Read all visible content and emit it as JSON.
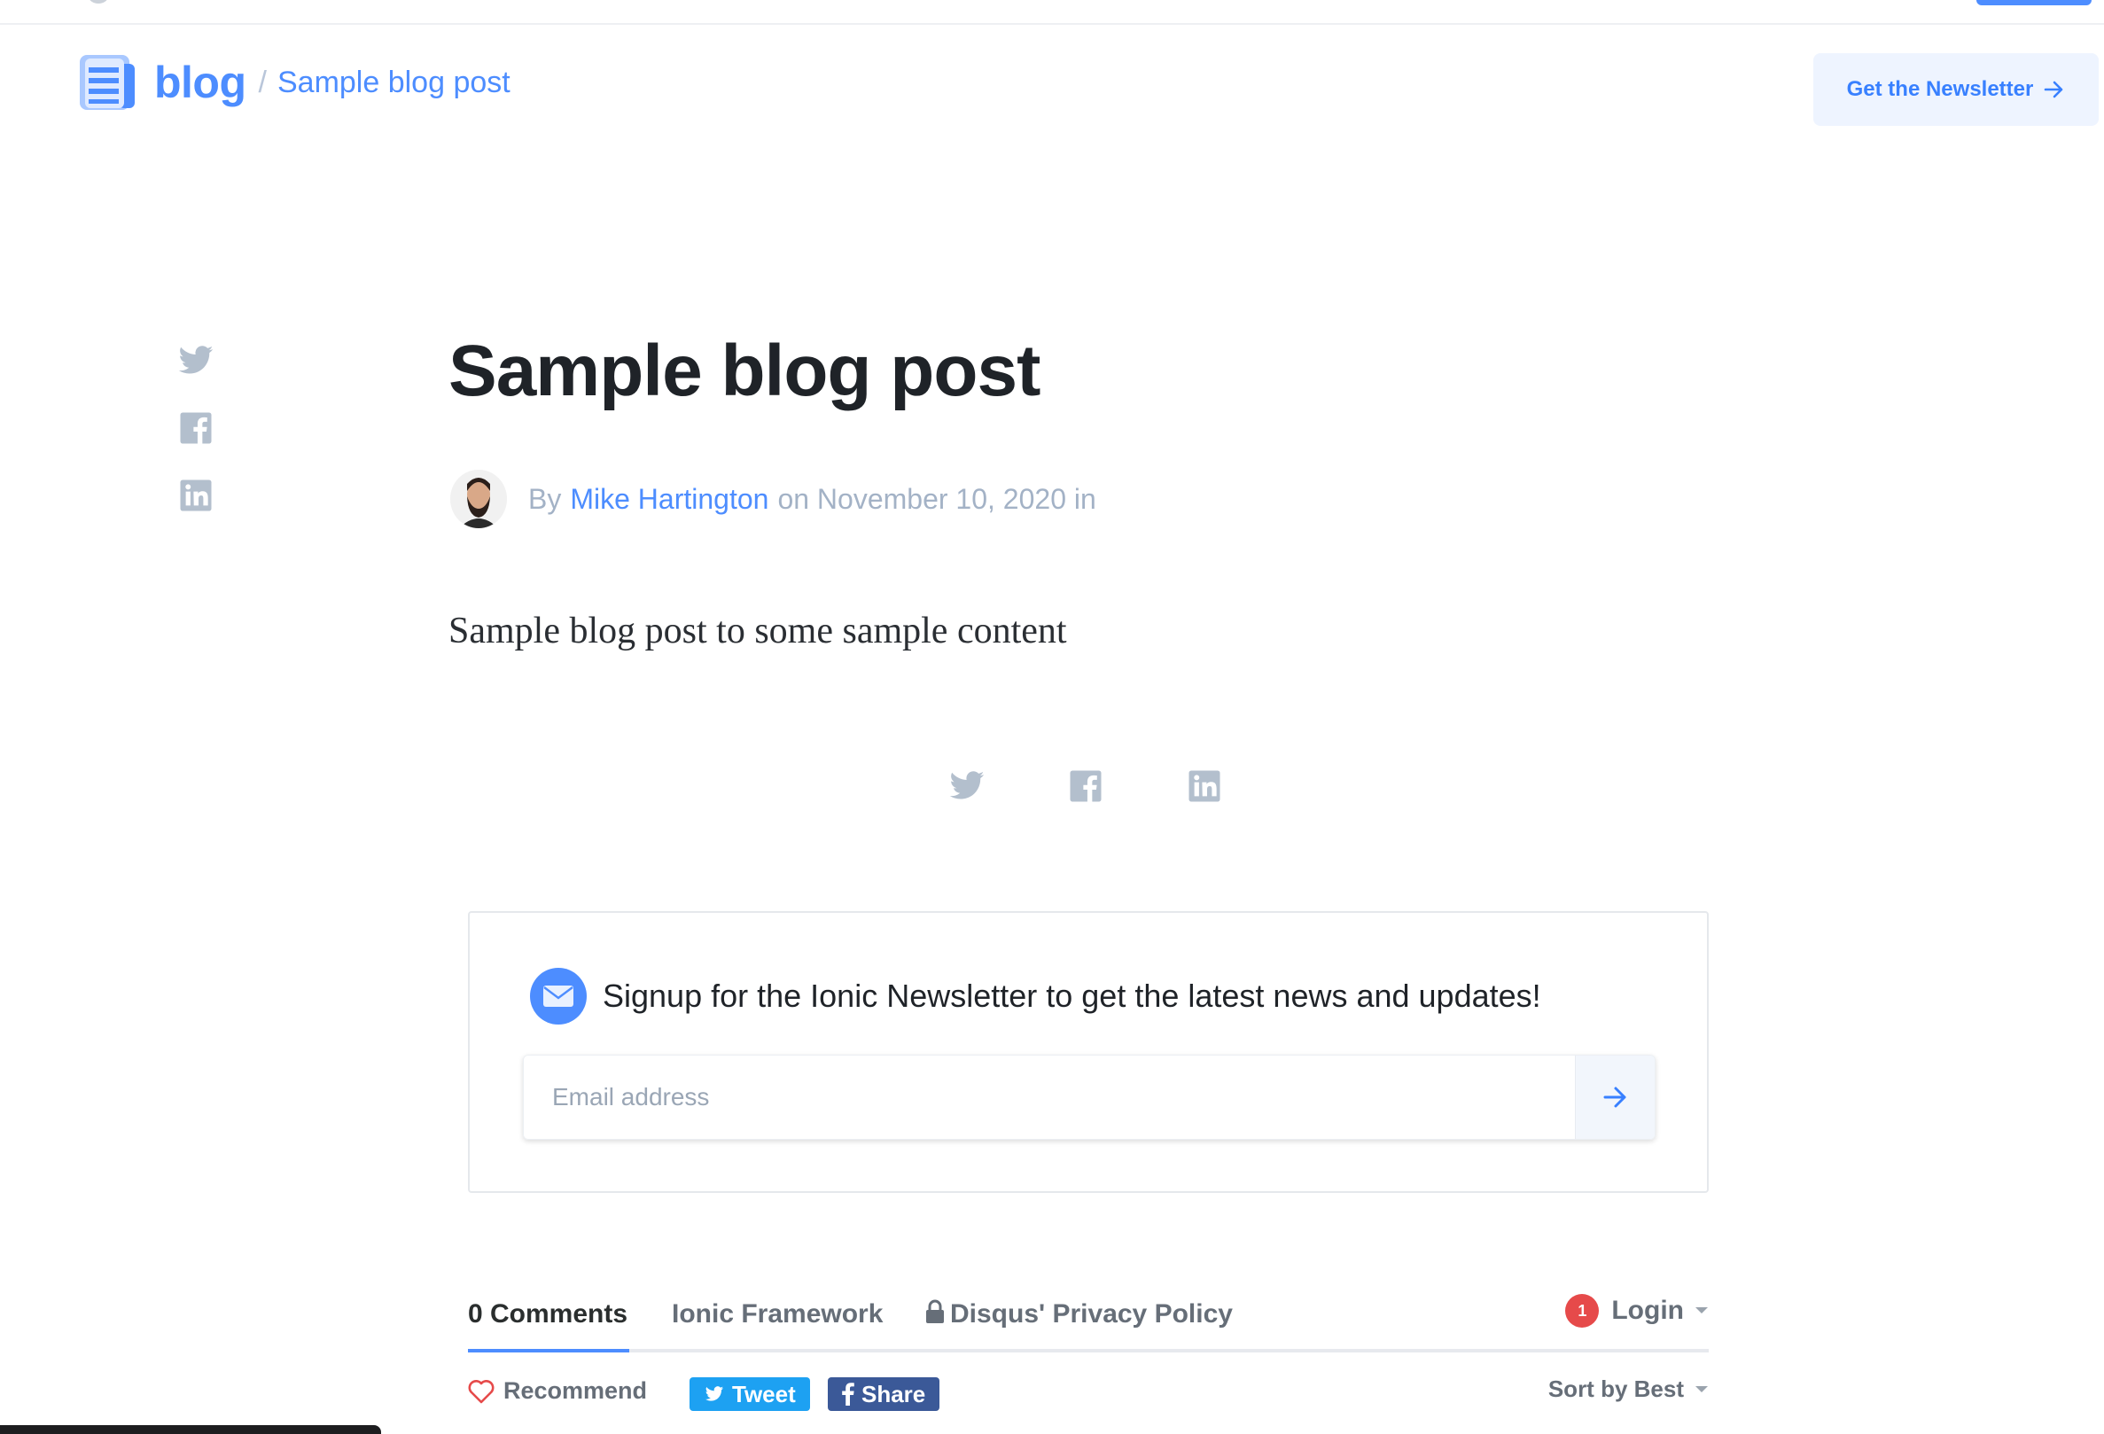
{
  "header": {
    "brand": "blog",
    "separator": "/",
    "breadcrumb": "Sample blog post",
    "newsletter_button": "Get the Newsletter"
  },
  "article": {
    "title": "Sample blog post",
    "by_label": "By",
    "author": "Mike Hartington",
    "date_text": "on November 10, 2020 in",
    "excerpt": "Sample blog post to some sample content"
  },
  "share_icons": [
    "twitter-icon",
    "facebook-icon",
    "linkedin-icon"
  ],
  "newsletter": {
    "headline": "Signup for the Ionic Newsletter to get the latest news and updates!",
    "email_placeholder": "Email address"
  },
  "disqus": {
    "tabs": [
      {
        "label": "0 Comments",
        "active": true
      },
      {
        "label": "Ionic Framework",
        "active": false
      },
      {
        "label": "Disqus' Privacy Policy",
        "active": false
      }
    ],
    "notification_count": "1",
    "login_label": "Login",
    "recommend_label": "Recommend",
    "tweet_label": "Tweet",
    "share_label": "Share",
    "sort_label": "Sort by Best"
  },
  "colors": {
    "accent": "#4d8dff",
    "muted": "#a3b2c6",
    "tweet": "#1da1f2",
    "facebook": "#3b5998",
    "notification": "#e64a4a"
  }
}
